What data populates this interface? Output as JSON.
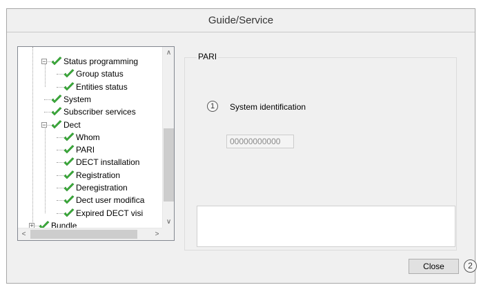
{
  "window": {
    "title": "Guide/Service"
  },
  "tree": {
    "items": [
      {
        "label": "Status programming",
        "level": 1,
        "expander": "−"
      },
      {
        "label": "Group status",
        "level": 2
      },
      {
        "label": "Entities status",
        "level": 2
      },
      {
        "label": "System",
        "level": 1
      },
      {
        "label": "Subscriber services",
        "level": 1
      },
      {
        "label": "Dect",
        "level": 1,
        "expander": "−"
      },
      {
        "label": "Whom",
        "level": 2
      },
      {
        "label": "PARI",
        "level": 2
      },
      {
        "label": "DECT installation",
        "level": 2
      },
      {
        "label": "Registration",
        "level": 2
      },
      {
        "label": "Deregistration",
        "level": 2
      },
      {
        "label": "Dect user modifica",
        "level": 2
      },
      {
        "label": "Expired DECT visi",
        "level": 2
      },
      {
        "label": "Bundle",
        "level": 0,
        "expander": "+"
      }
    ],
    "scroll_up": "∧",
    "scroll_down": "∨",
    "scroll_left": "<",
    "scroll_right": ">"
  },
  "panel": {
    "legend": "PARI",
    "marker1": "1",
    "system_identification_label": "System identification",
    "system_identification_value": "00000000000"
  },
  "footer": {
    "close_label": "Close",
    "marker2": "2"
  },
  "colors": {
    "check_green": "#3cae3c",
    "window_bg": "#f0f0f0"
  }
}
